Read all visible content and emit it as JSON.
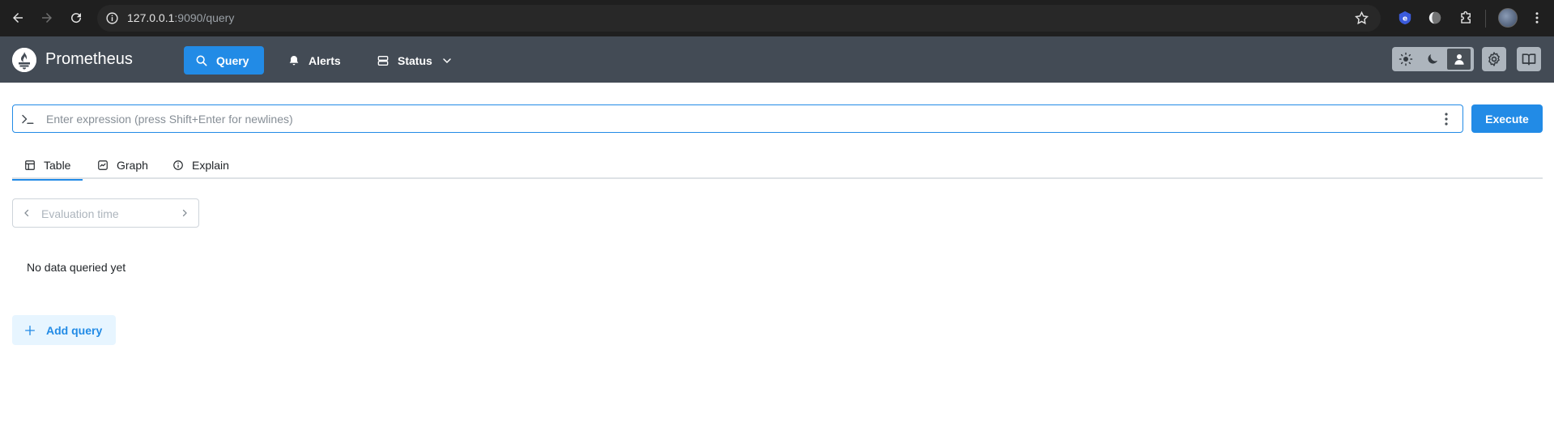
{
  "browser": {
    "url_host": "127.0.0.1",
    "url_rest": ":9090/query",
    "icons": [
      "back-arrow-icon",
      "forward-arrow-icon",
      "reload-icon",
      "site-info-icon",
      "bookmark-star-icon",
      "extension-e-icon",
      "extension-circle-icon",
      "extensions-puzzle-icon",
      "profile-avatar",
      "more-vertical-icon"
    ]
  },
  "header": {
    "brand": "Prometheus",
    "nav": [
      {
        "label": "Query",
        "icon": "search-icon",
        "active": true
      },
      {
        "label": "Alerts",
        "icon": "bell-icon"
      },
      {
        "label": "Status",
        "icon": "server-icon"
      }
    ],
    "theme_icons": [
      "sun-icon",
      "moon-icon",
      "user-icon"
    ],
    "right_icons": [
      "gear-icon",
      "book-icon"
    ]
  },
  "query": {
    "placeholder": "Enter expression (press Shift+Enter for newlines)",
    "execute_label": "Execute"
  },
  "tabs": [
    {
      "label": "Table",
      "icon": "table-icon",
      "active": true
    },
    {
      "label": "Graph",
      "icon": "graph-icon"
    },
    {
      "label": "Explain",
      "icon": "info-icon"
    }
  ],
  "eval_time": {
    "placeholder": "Evaluation time"
  },
  "status_text": "No data queried yet",
  "add_query_label": "Add query",
  "colors": {
    "accent": "#228be6",
    "header_bg": "#434b55",
    "browser_bg": "#1f1f1f"
  }
}
